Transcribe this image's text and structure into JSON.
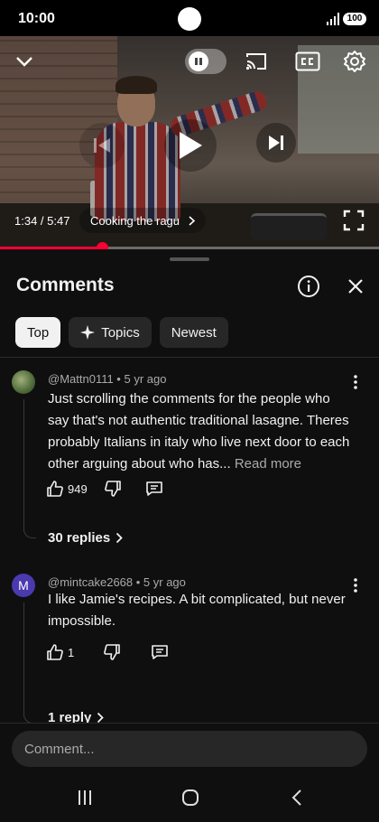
{
  "status_bar": {
    "time": "10:00",
    "battery": "100"
  },
  "player": {
    "timecode": "1:34 / 5:47",
    "chapter": "Cooking the ragu",
    "progress": 0.27,
    "accent": "#ff0033"
  },
  "comments_panel": {
    "title": "Comments",
    "chips": [
      {
        "label": "Top",
        "active": true
      },
      {
        "label": "Topics",
        "icon": "sparkle-icon",
        "active": false
      },
      {
        "label": "Newest",
        "active": false
      }
    ],
    "comments": [
      {
        "author": "@Mattn0111",
        "age": "5 yr ago",
        "meta": "@Mattn0111 • 5 yr ago",
        "text": "Just scrolling the comments for the people who say that's not authentic traditional lasagne. Theres probably Italians in italy who live next door to each other arguing about who has... ",
        "read_more": "Read more",
        "likes": "949",
        "replies": "30 replies"
      },
      {
        "author": "@mintcake2668",
        "age": "5 yr ago",
        "meta": "@mintcake2668 • 5 yr ago",
        "avatar_letter": "M",
        "text": "I like Jamie's recipes. A bit complicated, but never impossible.",
        "likes": "1",
        "replies": "1 reply"
      }
    ]
  },
  "composer": {
    "placeholder": "Comment..."
  }
}
